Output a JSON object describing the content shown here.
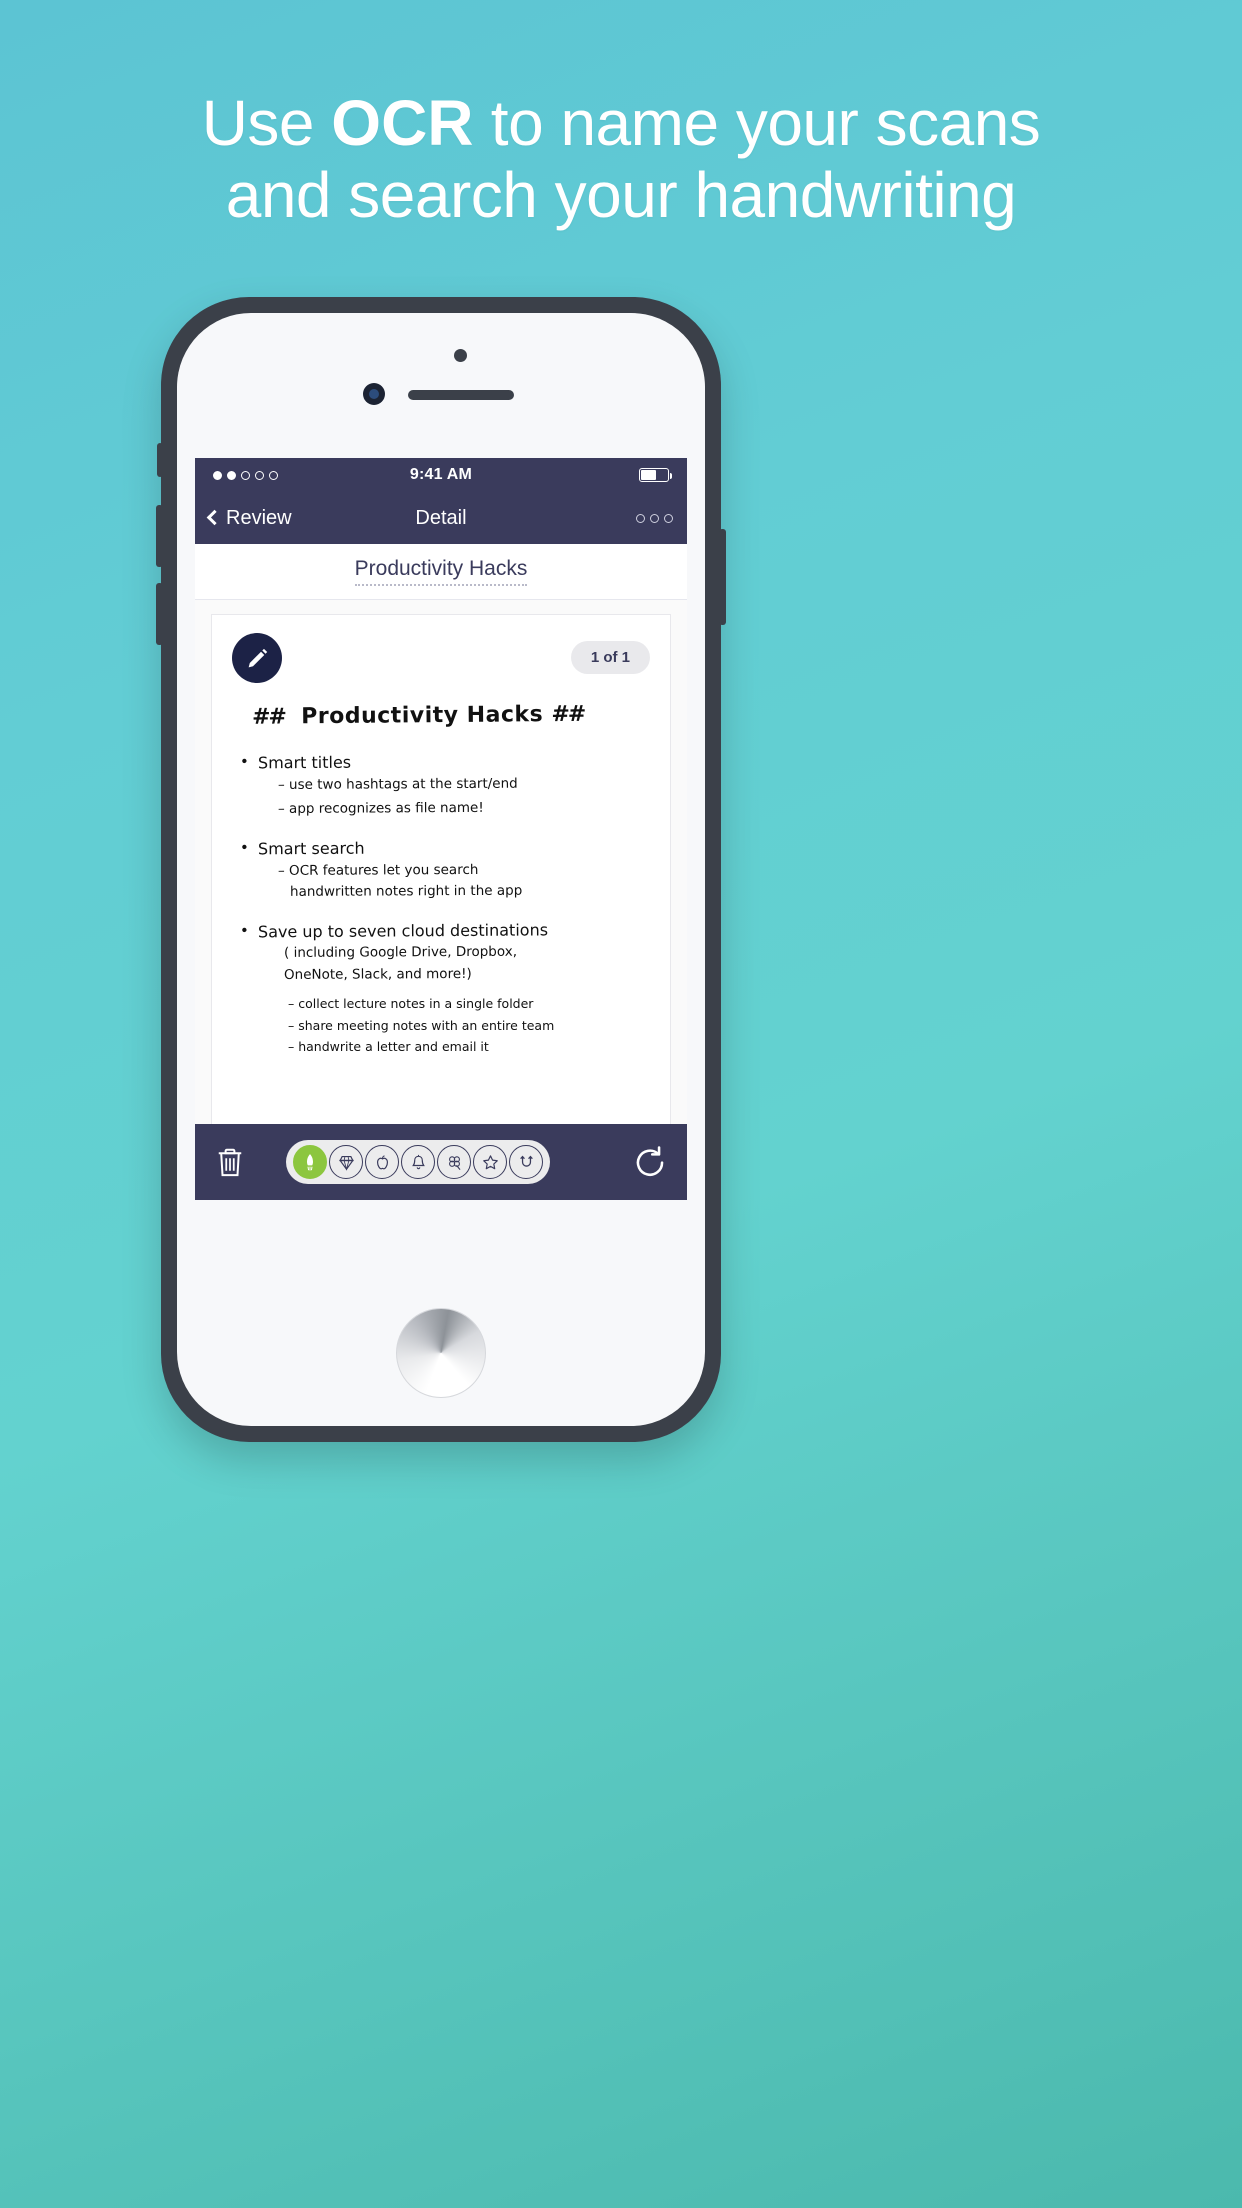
{
  "headline": {
    "line1_pre": "Use ",
    "line1_bold": "OCR",
    "line1_post": " to name your scans",
    "line2": "and search your handwriting"
  },
  "colors": {
    "bg_top": "#5cc4d3",
    "bg_bottom": "#4bb9ad",
    "nav_bar": "#3a3b5c",
    "accent_green": "#8cc63f",
    "fab_navy": "#1c2246"
  },
  "phone": {
    "status_bar": {
      "signal_dots_filled": 2,
      "signal_dots_total": 5,
      "time": "9:41 AM",
      "battery_level_pct": 52
    },
    "nav_bar": {
      "back_label": "Review",
      "title": "Detail",
      "more_icon": "three-circles-icon"
    },
    "document": {
      "title": "Productivity Hacks",
      "page_count": "1 of 1",
      "edit_icon": "pencil-icon"
    },
    "note": {
      "heading": "##  Productivity Hacks ##",
      "heading_hash_left": "##",
      "heading_text": "Productivity Hacks",
      "heading_hash_right": "##",
      "blocks": [
        {
          "bullet": "Smart titles",
          "sub": [
            "– use two hashtags at the start/end",
            "– app recognizes as file name!"
          ]
        },
        {
          "bullet": "Smart search",
          "sub": [
            "– OCR features let you search",
            "handwritten notes right in the app"
          ]
        },
        {
          "bullet": "Save up to seven cloud destinations",
          "paren": [
            "( including Google Drive, Dropbox,",
            "OneNote, Slack, and more!)"
          ],
          "tight": [
            "– collect lecture notes in a single folder",
            "– share meeting notes with an entire team",
            "– handwrite a letter and email it"
          ]
        }
      ]
    },
    "toolbar": {
      "delete_icon": "trash-icon",
      "rotate_icon": "rotate-left-icon",
      "tags": [
        {
          "name": "rocket-icon",
          "active": true
        },
        {
          "name": "diamond-icon",
          "active": false
        },
        {
          "name": "apple-icon",
          "active": false
        },
        {
          "name": "bell-icon",
          "active": false
        },
        {
          "name": "clover-icon",
          "active": false
        },
        {
          "name": "star-icon",
          "active": false
        },
        {
          "name": "loop-icon",
          "active": false
        }
      ]
    }
  }
}
